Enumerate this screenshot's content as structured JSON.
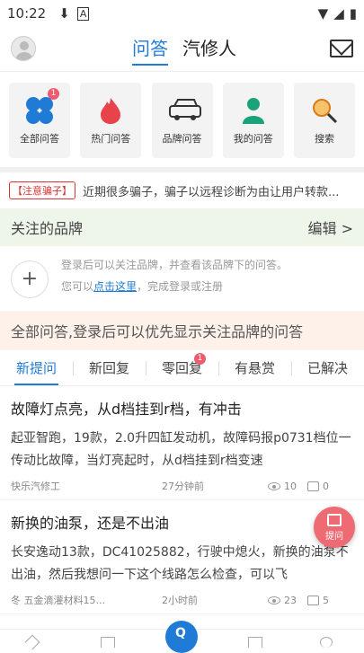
{
  "status_bar": {
    "time": "10:22"
  },
  "header": {
    "tabs": [
      {
        "label": "问答",
        "active": true
      },
      {
        "label": "汽修人",
        "active": false
      }
    ]
  },
  "quick_entries": [
    {
      "label": "全部问答",
      "icon": "clover-icon",
      "badge": "1"
    },
    {
      "label": "热门问答",
      "icon": "flame-icon"
    },
    {
      "label": "品牌问答",
      "icon": "car-icon"
    },
    {
      "label": "我的问答",
      "icon": "person-icon"
    },
    {
      "label": "搜索",
      "icon": "search-icon"
    }
  ],
  "notice": {
    "tag": "【注意骗子】",
    "text": "近期很多骗子，骗子以远程诊断为由让用户转款..."
  },
  "follow": {
    "title": "关注的品牌",
    "edit_label": "编辑 >",
    "line1": "登录后可以关注品牌，并查看该品牌下的问答。",
    "line2_prefix": "您可以",
    "link": "点击这里",
    "line2_suffix": "，完成登录或注册"
  },
  "login_banner": "全部问答,登录后可以优先显示关注品牌的问答",
  "filters": [
    {
      "label": "新提问",
      "active": true
    },
    {
      "label": "新回复"
    },
    {
      "label": "零回复",
      "badge": "1"
    },
    {
      "label": "有悬赏"
    },
    {
      "label": "已解决"
    }
  ],
  "questions": [
    {
      "title": "故障灯点亮，从d档挂到r档，有冲击",
      "desc": "起亚智跑，19款，2.0升四缸发动机，故障码报p0731档位一传动比故障，当灯亮起时，从d档挂到r档变速",
      "user": "快乐汽修工",
      "time": "27分钟前",
      "views": "10",
      "comments": "0"
    },
    {
      "title": "新换的油泵，还是不出油",
      "desc": "长安逸动13款，DC41025882，行驶中熄火，新换的油泵不出油，然后我想问一下这个线路怎么检查，可以飞",
      "user": "冬 五金滴灌材料15...",
      "time": "2小时前",
      "views": "23",
      "comments": "5"
    }
  ],
  "ask_button": "提问",
  "colors": {
    "accent": "#1f7bd6",
    "badge": "#ef5a6c",
    "ask": "#ef6b73"
  }
}
